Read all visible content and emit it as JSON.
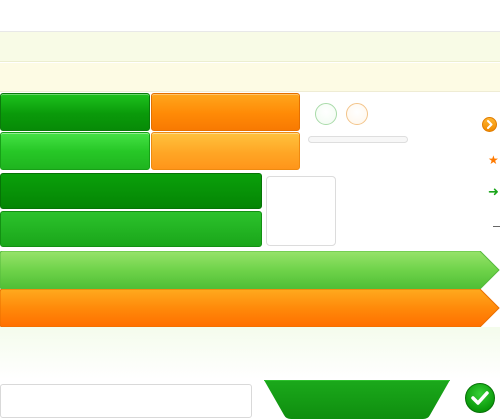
{
  "colors": {
    "green_dark": "#0a9a0a",
    "green_light": "#27c827",
    "orange_dark": "#ff8a06",
    "orange_light": "#ffa625",
    "arrow_green": "#6fd34a",
    "arrow_orange": "#ff7a00",
    "band_yellow": "#fdfbe4",
    "band_green": "#f8fbe6"
  },
  "icons": {
    "chevron": "chevron-right-icon",
    "star": "star-icon",
    "arrow": "arrow-right-icon",
    "check": "check-icon"
  }
}
